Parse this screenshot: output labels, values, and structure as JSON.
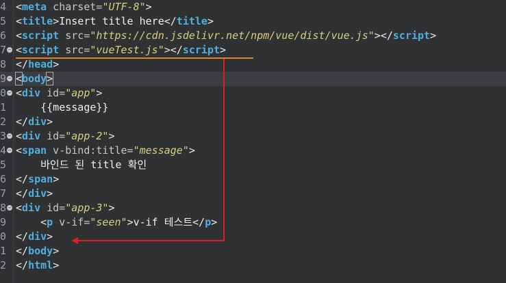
{
  "editor": {
    "line_numbers": [
      "4",
      "5",
      "6",
      "7",
      "8",
      "9",
      "0",
      "1",
      "2",
      "3",
      "4",
      "5",
      "6",
      "7",
      "8",
      "9",
      "0",
      "1",
      "2"
    ],
    "code": {
      "l4": {
        "open": "<",
        "name": "meta",
        "attr": " charset=",
        "val": "\"UTF-8\"",
        "close": ">"
      },
      "l5": {
        "open": "<",
        "name": "title",
        "gt": ">",
        "text": "Insert title here",
        "end_open": "</",
        "end_name": "title",
        "end_close": ">"
      },
      "l6": {
        "open": "<",
        "name": "script",
        "attr": " src=",
        "val": "\"https://cdn.jsdelivr.net/npm/vue/dist/vue.js\"",
        "gt": ">",
        "end_open": "</",
        "end_name": "script",
        "end_close": ">"
      },
      "l7": {
        "open": "<",
        "name": "script",
        "attr": " src=",
        "val": "\"vueTest.js\"",
        "gt": ">",
        "end_open": "</",
        "end_name": "script",
        "end_close": ">"
      },
      "l8": {
        "end_open": "</",
        "end_name": "head",
        "end_close": ">"
      },
      "l9": {
        "open": "<",
        "name": "body",
        "close": ">"
      },
      "l10": {
        "open": "<",
        "name": "div",
        "attr": " id=",
        "val": "\"app\"",
        "close": ">"
      },
      "l11": {
        "text": "    {{message}}"
      },
      "l12": {
        "end_open": "</",
        "end_name": "div",
        "end_close": ">"
      },
      "l13": {
        "open": "<",
        "name": "div",
        "attr": " id=",
        "val": "\"app-2\"",
        "close": ">"
      },
      "l14": {
        "open": "<",
        "name": "span",
        "attr": " v-bind:title=",
        "val": "\"message\"",
        "close": ">"
      },
      "l15": {
        "text": "    바인드 된 title 확인"
      },
      "l16": {
        "end_open": "</",
        "end_name": "span",
        "end_close": ">"
      },
      "l17": {
        "end_open": "</",
        "end_name": "div",
        "end_close": ">"
      },
      "l18": {
        "open": "<",
        "name": "div",
        "attr": " id=",
        "val": "\"app-3\"",
        "close": ">"
      },
      "l19": {
        "indent": "    ",
        "open": "<",
        "name": "p",
        "attr": " v-if=",
        "val": "\"seen\"",
        "gt": ">",
        "text": "v-if 테스트",
        "end_open": "</",
        "end_name": "p",
        "end_close": ">"
      },
      "l20": {
        "end_open": "</",
        "end_name": "div",
        "end_close": ">"
      },
      "l21": {
        "end_open": "</",
        "end_name": "body",
        "end_close": ">"
      },
      "l22": {
        "end_open": "</",
        "end_name": "html",
        "end_close": ">"
      }
    }
  },
  "colors": {
    "background": "#2f3133",
    "tag_name": "#51b0e0",
    "attr_value": "#d7d080",
    "annotation_arrow": "#e02020",
    "annotation_underline": "#e4832c"
  }
}
